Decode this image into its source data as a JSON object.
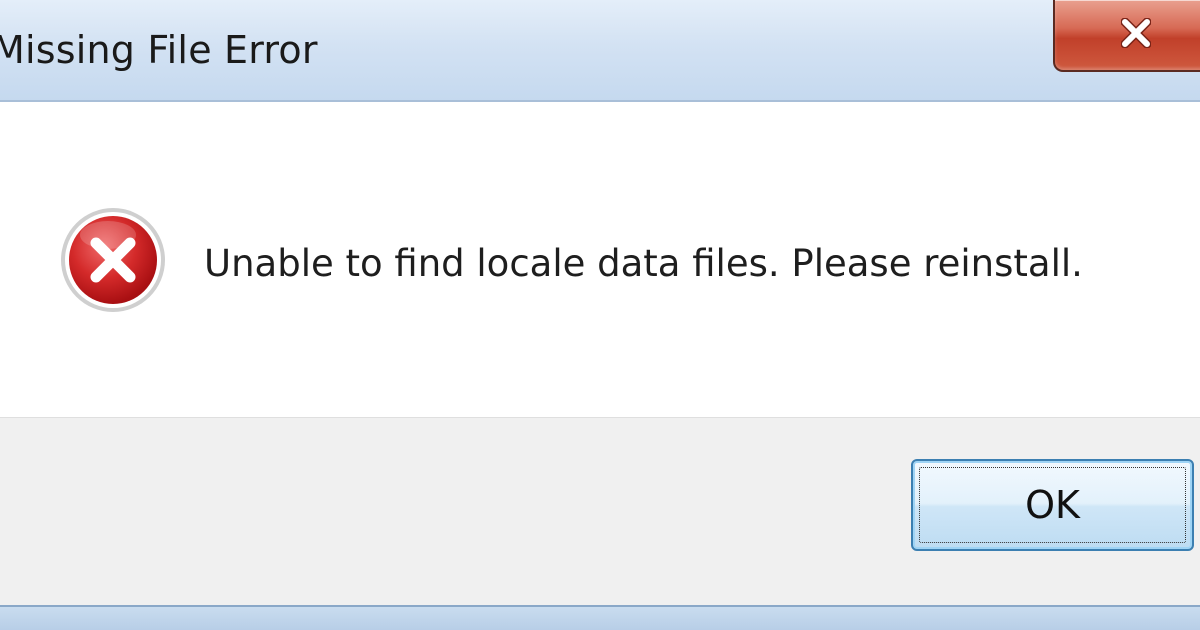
{
  "window": {
    "title": "Missing File Error",
    "close_icon": "close-icon"
  },
  "dialog": {
    "icon": "error-icon",
    "message": "Unable to find locale data files. Please reinstall."
  },
  "buttons": {
    "ok_label": "OK"
  },
  "colors": {
    "titlebar": "#c5d9ef",
    "close_button": "#c1402a",
    "error_icon": "#c4161c",
    "footer": "#f0f0f0",
    "ok_border": "#3c7fb1"
  }
}
